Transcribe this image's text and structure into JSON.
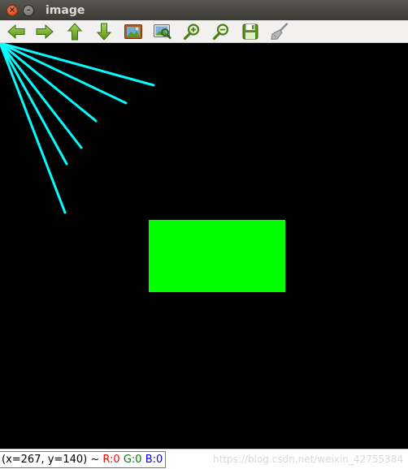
{
  "window": {
    "title": "image",
    "close_glyph": "×",
    "minimize_glyph": "–"
  },
  "toolbar": {
    "buttons": [
      {
        "name": "pan-left",
        "icon": "arrow-left-icon"
      },
      {
        "name": "pan-right",
        "icon": "arrow-right-icon"
      },
      {
        "name": "pan-up",
        "icon": "arrow-up-icon"
      },
      {
        "name": "pan-down",
        "icon": "arrow-down-icon"
      },
      {
        "name": "zoom-fit",
        "icon": "picture-icon"
      },
      {
        "name": "zoom-area",
        "icon": "zoom-image-icon"
      },
      {
        "name": "zoom-in",
        "icon": "zoom-in-icon"
      },
      {
        "name": "zoom-out",
        "icon": "zoom-out-icon"
      },
      {
        "name": "save",
        "icon": "save-icon"
      },
      {
        "name": "properties",
        "icon": "brush-icon"
      }
    ]
  },
  "image": {
    "background_color": "#000000",
    "line_color": "#00ffff",
    "rect_color": "#00ff00"
  },
  "status": {
    "coords": "(x=267, y=140) ~",
    "r_label": "R:0",
    "g_label": "G:0",
    "b_label": "B:0",
    "r_color": "#ff0000",
    "g_color": "#008000",
    "b_color": "#0000ff"
  },
  "watermark": {
    "text": "https://blog.csdn.net/weixin_42755384"
  }
}
